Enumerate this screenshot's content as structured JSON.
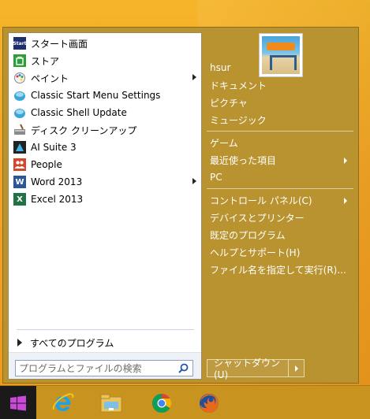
{
  "left_menu": {
    "items": [
      {
        "label": "スタート画面",
        "icon": "start-screen-icon",
        "color": "#1e2f6e",
        "has_arrow": false
      },
      {
        "label": "ストア",
        "icon": "store-icon",
        "color": "#2e9e3a",
        "has_arrow": false
      },
      {
        "label": "ペイント",
        "icon": "paint-icon",
        "color": "#3a7bd5",
        "has_arrow": true
      },
      {
        "label": "Classic Start Menu Settings",
        "icon": "classic-shell-icon",
        "color": "#3aa7d8",
        "has_arrow": false
      },
      {
        "label": "Classic Shell Update",
        "icon": "classic-shell-icon",
        "color": "#3aa7d8",
        "has_arrow": false
      },
      {
        "label": "ディスク クリーンアップ",
        "icon": "disk-cleanup-icon",
        "color": "#6c6c6c",
        "has_arrow": false
      },
      {
        "label": "AI Suite 3",
        "icon": "ai-suite-icon",
        "color": "#222222",
        "has_arrow": false
      },
      {
        "label": "People",
        "icon": "people-icon",
        "color": "#d5472b",
        "has_arrow": false
      },
      {
        "label": "Word 2013",
        "icon": "word-icon",
        "color": "#2b579a",
        "has_arrow": true
      },
      {
        "label": "Excel 2013",
        "icon": "excel-icon",
        "color": "#217346",
        "has_arrow": false
      }
    ],
    "all_programs": "すべてのプログラム",
    "search_placeholder": "プログラムとファイルの検索"
  },
  "right_menu": {
    "user": "hsur",
    "items": [
      {
        "label": "ドキュメント",
        "has_arrow": false
      },
      {
        "label": "ピクチャ",
        "has_arrow": false
      },
      {
        "label": "ミュージック",
        "has_arrow": false
      },
      {
        "label": "ゲーム",
        "has_arrow": false
      },
      {
        "label": "最近使った項目",
        "has_arrow": true
      },
      {
        "label": "PC",
        "has_arrow": false
      },
      {
        "label": "コントロール パネル(C)",
        "has_arrow": true
      },
      {
        "label": "デバイスとプリンター",
        "has_arrow": false
      },
      {
        "label": "既定のプログラム",
        "has_arrow": false
      },
      {
        "label": "ヘルプとサポート(H)",
        "has_arrow": false
      },
      {
        "label": "ファイル名を指定して実行(R)...",
        "has_arrow": false
      }
    ],
    "shutdown": "シャットダウン(U)"
  },
  "taskbar": {
    "icons": [
      "windows-start-icon",
      "internet-explorer-icon",
      "file-explorer-icon",
      "chrome-icon",
      "firefox-icon"
    ]
  },
  "colors": {
    "menu_bg": "#b99330",
    "desktop": "#f3a423",
    "taskbar": "#c9931f"
  }
}
